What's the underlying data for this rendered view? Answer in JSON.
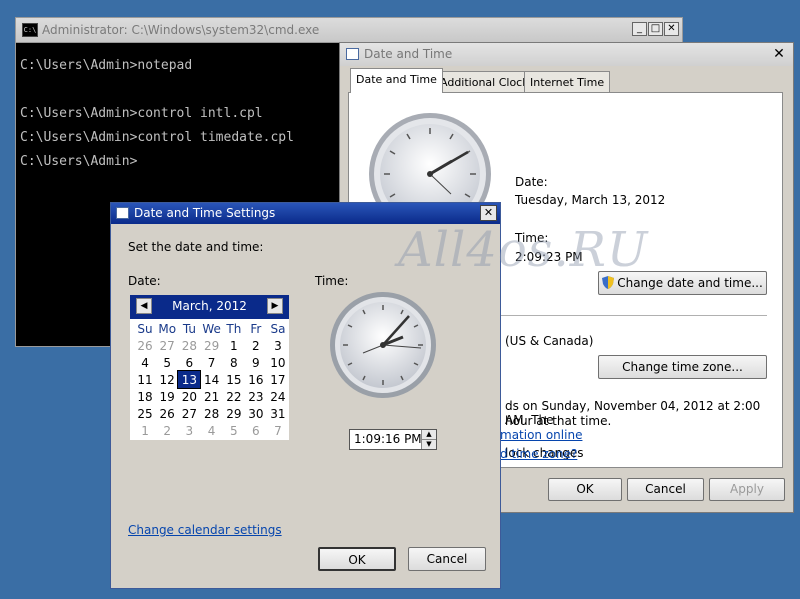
{
  "cmd": {
    "title": "Administrator: C:\\Windows\\system32\\cmd.exe",
    "icon": "C:\\",
    "lines": [
      "C:\\Users\\Admin>notepad",
      "",
      "C:\\Users\\Admin>control intl.cpl",
      "C:\\Users\\Admin>control timedate.cpl",
      "C:\\Users\\Admin>"
    ]
  },
  "datetime_dialog": {
    "title": "Date and Time",
    "tabs": [
      "Date and Time",
      "Additional Clocks",
      "Internet Time"
    ],
    "date_label": "Date:",
    "date_value": "Tuesday, March 13, 2012",
    "time_label": "Time:",
    "time_value": "2:09:23 PM",
    "change_datetime_button": "Change date and time...",
    "timezone_partial": "(US & Canada)",
    "change_timezone_button": "Change time zone...",
    "dst_line1": "ds on Sunday, November 04, 2012 at 2:00 AM. The",
    "dst_line2": "hour at that time.",
    "notify_partial": "lock changes",
    "link_info": "mation online",
    "link_timezone": "d time zone?",
    "ok": "OK",
    "cancel": "Cancel",
    "apply": "Apply"
  },
  "settings_dialog": {
    "title": "Date and Time Settings",
    "instruction": "Set the date and time:",
    "date_label": "Date:",
    "time_label": "Time:",
    "calendar": {
      "month": "March, 2012",
      "days_of_week": [
        "Su",
        "Mo",
        "Tu",
        "We",
        "Th",
        "Fr",
        "Sa"
      ],
      "weeks": [
        [
          "26",
          "27",
          "28",
          "29",
          "1",
          "2",
          "3"
        ],
        [
          "4",
          "5",
          "6",
          "7",
          "8",
          "9",
          "10"
        ],
        [
          "11",
          "12",
          "13",
          "14",
          "15",
          "16",
          "17"
        ],
        [
          "18",
          "19",
          "20",
          "21",
          "22",
          "23",
          "24"
        ],
        [
          "25",
          "26",
          "27",
          "28",
          "29",
          "30",
          "31"
        ],
        [
          "1",
          "2",
          "3",
          "4",
          "5",
          "6",
          "7"
        ]
      ],
      "selected": "13"
    },
    "time_value": "1:09:16 PM",
    "link_calendar": "Change calendar settings",
    "ok": "OK",
    "cancel": "Cancel"
  },
  "watermark": "All4os.RU",
  "colors": {
    "desktop": "#3a6ea5",
    "accent": "#0a2a8a",
    "link": "#0645ad"
  }
}
